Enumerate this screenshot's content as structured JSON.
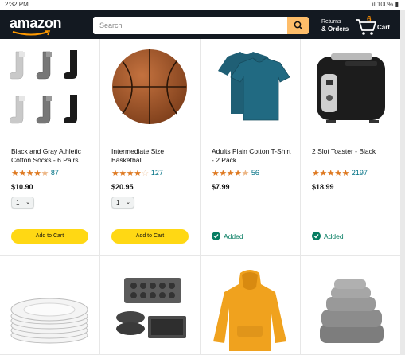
{
  "status_bar": {
    "time": "2:32 PM",
    "battery": "100%"
  },
  "header": {
    "logo": "amazon",
    "search_placeholder": "Search",
    "orders_line1": "Returns",
    "orders_line2": "& Orders",
    "cart_count": "6",
    "cart_label": "Cart"
  },
  "products": [
    {
      "name": "Black and Gray Athletic Cotton Socks - 6 Pairs",
      "stars": 4.5,
      "rating_count": "87",
      "price": "$10.90",
      "quantity": "1",
      "action": "Add to Cart"
    },
    {
      "name": "Intermediate Size Basketball",
      "stars": 4,
      "rating_count": "127",
      "price": "$20.95",
      "quantity": "1",
      "action": "Add to Cart"
    },
    {
      "name": "Adults Plain Cotton T-Shirt - 2 Pack",
      "stars": 4.5,
      "rating_count": "56",
      "price": "$7.99",
      "action": "Added"
    },
    {
      "name": "2 Slot Toaster - Black",
      "stars": 5,
      "rating_count": "2197",
      "price": "$18.99",
      "action": "Added"
    }
  ],
  "colors": {
    "header_bg": "#131921",
    "search_button": "#febd69",
    "add_button": "#ffd814",
    "star": "#de7921",
    "link": "#007185",
    "added": "#067d62"
  }
}
